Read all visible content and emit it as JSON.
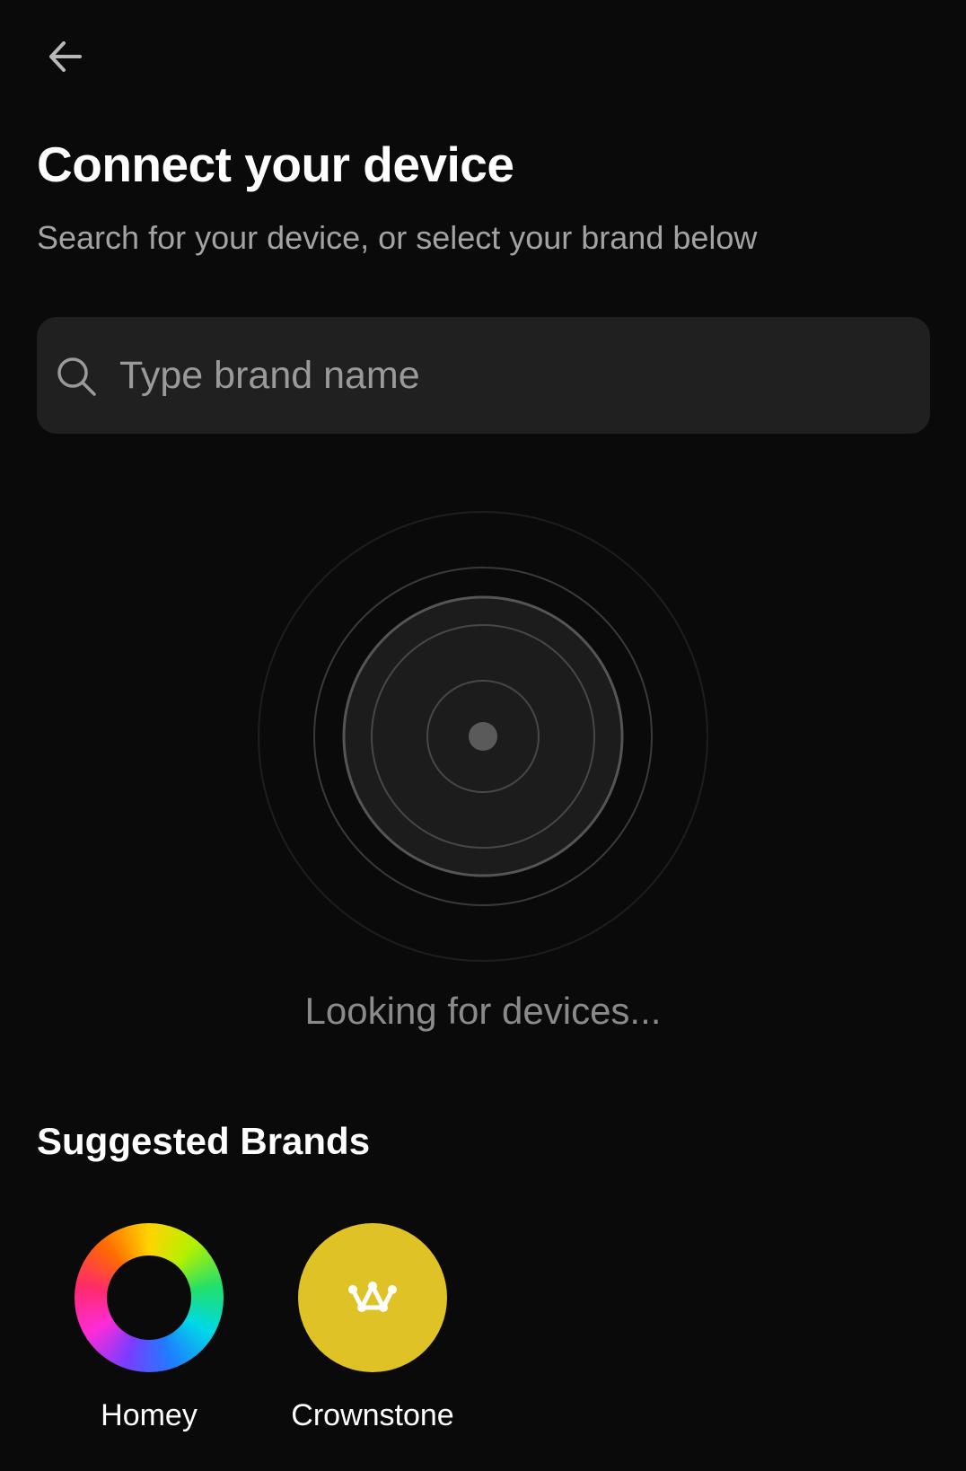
{
  "header": {
    "back_icon": "arrow-left-icon",
    "title": "Connect your device",
    "subtitle": "Search for your device, or select your brand below"
  },
  "search": {
    "icon": "search-icon",
    "placeholder": "Type brand name",
    "value": ""
  },
  "scanner": {
    "icon": "radar-icon",
    "status": "Looking for devices..."
  },
  "suggested": {
    "title": "Suggested Brands",
    "brands": [
      {
        "name": "Homey",
        "logo": "homey-logo-icon"
      },
      {
        "name": "Crownstone",
        "logo": "crownstone-logo-icon",
        "color": "#dfc226"
      }
    ]
  },
  "colors": {
    "background": "#0a0a0a",
    "surface": "#202020",
    "text_primary": "#ffffff",
    "text_secondary": "#a3a3a3",
    "text_muted": "#8a8a8a"
  }
}
